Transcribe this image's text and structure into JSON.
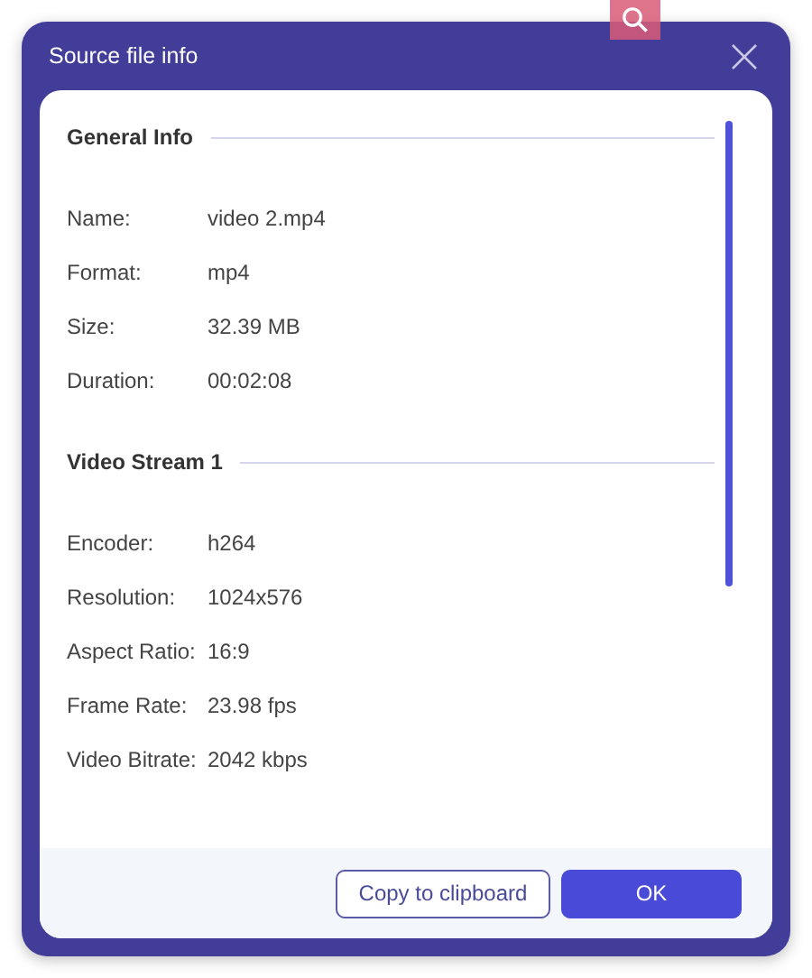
{
  "window": {
    "title": "Source file info"
  },
  "sections": [
    {
      "title": "General Info",
      "rows": [
        {
          "label": "Name:",
          "value": "video 2.mp4"
        },
        {
          "label": "Format:",
          "value": "mp4"
        },
        {
          "label": "Size:",
          "value": "32.39 MB"
        },
        {
          "label": "Duration:",
          "value": "00:02:08"
        }
      ]
    },
    {
      "title": "Video Stream 1",
      "rows": [
        {
          "label": "Encoder:",
          "value": "h264"
        },
        {
          "label": "Resolution:",
          "value": "1024x576"
        },
        {
          "label": "Aspect Ratio:",
          "value": "16:9"
        },
        {
          "label": "Frame Rate:",
          "value": "23.98 fps"
        },
        {
          "label": "Video Bitrate:",
          "value": "2042 kbps"
        }
      ]
    }
  ],
  "buttons": [
    {
      "label": "Copy to clipboard",
      "kind": "secondary"
    },
    {
      "label": "OK",
      "kind": "primary"
    }
  ]
}
